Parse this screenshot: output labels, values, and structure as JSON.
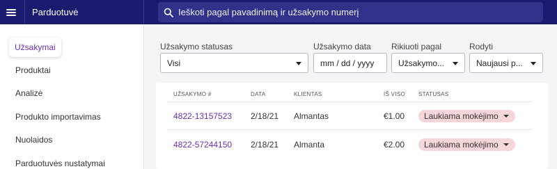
{
  "app": {
    "title": "Parduotuvė"
  },
  "search": {
    "placeholder": "Ieškoti pagal pavadinimą ir užsakymo numerį"
  },
  "sidebar": {
    "items": [
      {
        "label": "Užsakymai",
        "active": true
      },
      {
        "label": "Produktai"
      },
      {
        "label": "Analizė"
      },
      {
        "label": "Produkto importavimas"
      },
      {
        "label": "Nuolaidos"
      },
      {
        "label": "Parduotuvės nustatymai"
      }
    ]
  },
  "filters": {
    "status": {
      "label": "Užsakymo statusas",
      "value": "Visi"
    },
    "date": {
      "label": "Užsakymo data",
      "placeholder": "mm / dd / yyyy"
    },
    "sort": {
      "label": "Rikiuoti pagal",
      "value": "Užsakymo..."
    },
    "show": {
      "label": "Rodyti",
      "value": "Naujausi p..."
    }
  },
  "table": {
    "headers": [
      "UŽSAKYMO #",
      "DATA",
      "KLIENTAS",
      "IŠ VISO",
      "STATUSAS"
    ],
    "rows": [
      {
        "order": "4822-13157523",
        "date": "2/18/21",
        "client": "Almantas",
        "total": "€1.00",
        "status": "Laukiama mokėjimo"
      },
      {
        "order": "4822-57244150",
        "date": "2/18/21",
        "client": "Almanta",
        "total": "€2.00",
        "status": "Laukiama mokėjimo"
      }
    ]
  },
  "colors": {
    "topbar": "#1a1a6e",
    "search_bg": "#31318a",
    "accent": "#6b2fb3",
    "badge": "#f7d6d9"
  },
  "icons": {
    "menu": "hamburger-icon",
    "search": "search-icon",
    "dropdown": "caret-down-icon"
  }
}
